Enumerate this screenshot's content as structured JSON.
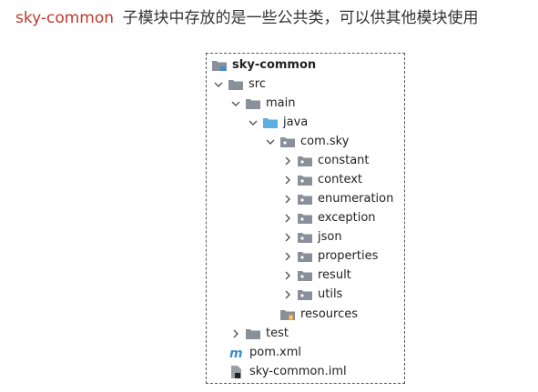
{
  "heading": {
    "module_name": "sky-common",
    "description": "子模块中存放的是一些公共类，可以供其他模块使用"
  },
  "tree": {
    "items": [
      {
        "label": "sky-common",
        "icon": "module-folder-icon",
        "expanded": null
      },
      {
        "label": "src",
        "icon": "folder-icon",
        "expanded": true
      },
      {
        "label": "main",
        "icon": "folder-icon",
        "expanded": true
      },
      {
        "label": "java",
        "icon": "source-folder-icon",
        "expanded": true
      },
      {
        "label": "com.sky",
        "icon": "package-icon",
        "expanded": true
      },
      {
        "label": "constant",
        "icon": "package-icon",
        "expanded": false
      },
      {
        "label": "context",
        "icon": "package-icon",
        "expanded": false
      },
      {
        "label": "enumeration",
        "icon": "package-icon",
        "expanded": false
      },
      {
        "label": "exception",
        "icon": "package-icon",
        "expanded": false
      },
      {
        "label": "json",
        "icon": "package-icon",
        "expanded": false
      },
      {
        "label": "properties",
        "icon": "package-icon",
        "expanded": false
      },
      {
        "label": "result",
        "icon": "package-icon",
        "expanded": false
      },
      {
        "label": "utils",
        "icon": "package-icon",
        "expanded": false
      },
      {
        "label": "resources",
        "icon": "resources-folder-icon",
        "expanded": null
      },
      {
        "label": "test",
        "icon": "folder-icon",
        "expanded": false
      },
      {
        "label": "pom.xml",
        "icon": "maven-icon",
        "expanded": null
      },
      {
        "label": "sky-common.iml",
        "icon": "iml-file-icon",
        "expanded": null
      }
    ]
  },
  "colors": {
    "module_name": "#c0392b",
    "folder": "#8a9099",
    "source_folder": "#5aaee0",
    "maven": "#3f8ec9",
    "resources_badge": "#e8a33d"
  }
}
